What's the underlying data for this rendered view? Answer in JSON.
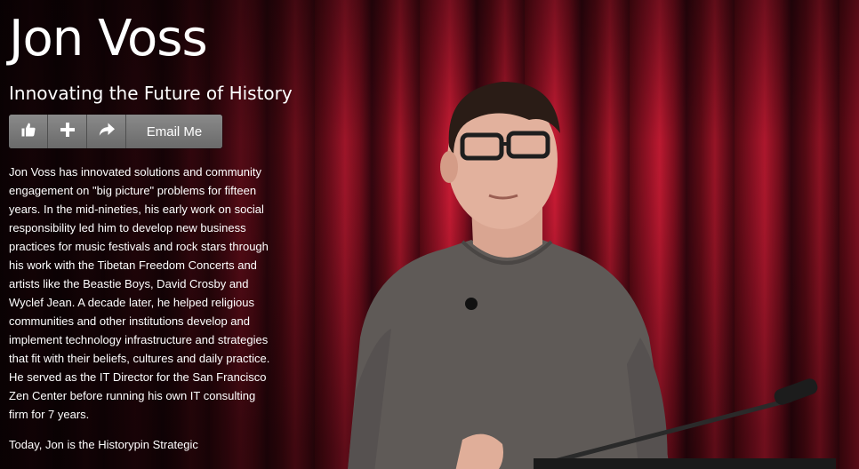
{
  "profile": {
    "name": "Jon Voss",
    "tagline": "Innovating the Future of History"
  },
  "actions": {
    "like_icon": "thumbs-up-icon",
    "add_icon": "plus-icon",
    "share_icon": "share-arrow-icon",
    "email_label": "Email Me"
  },
  "bio": {
    "paragraph_1": "Jon Voss has innovated solutions and community engagement on \"big picture\" problems for fifteen years. In the mid-nineties, his early work on social responsibility led him to develop new business practices for music festivals and rock stars through his work with the Tibetan Freedom Concerts and artists like the Beastie Boys, David Crosby and Wyclef Jean. A decade later, he helped religious communities and other institutions develop and implement technology infrastructure and strategies that fit with their beliefs, cultures and daily practice. He served as the IT Director for the San Francisco Zen Center before running his own IT consulting firm for 7 years.",
    "paragraph_2": "Today, Jon is the Historypin Strategic"
  },
  "colors": {
    "curtain_red": "#b0172c",
    "button_gray": "#7a7a7a",
    "text": "#ffffff"
  }
}
